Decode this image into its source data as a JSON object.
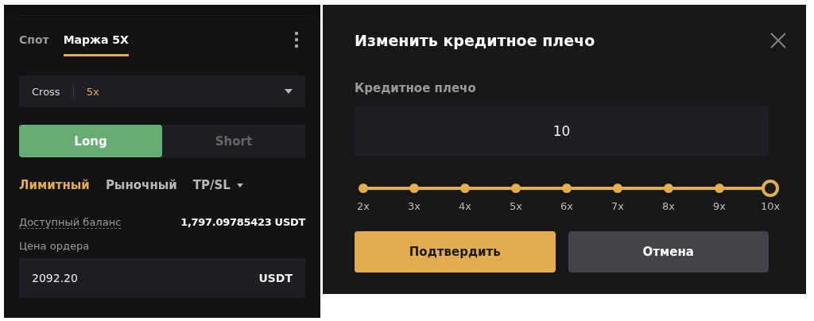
{
  "left_panel": {
    "tabs": [
      {
        "label": "Спот",
        "selected": false
      },
      {
        "label": "Маржа 5X",
        "selected": true
      }
    ],
    "margin_select": {
      "mode": "Cross",
      "leverage": "5x"
    },
    "sides": [
      {
        "label": "Long",
        "selected": true
      },
      {
        "label": "Short",
        "selected": false
      }
    ],
    "order_types": [
      {
        "label": "Лимитный",
        "selected": true,
        "kind": "tab"
      },
      {
        "label": "Рыночный",
        "selected": false,
        "kind": "tab"
      },
      {
        "label": "TP/SL",
        "selected": false,
        "kind": "dropdown"
      }
    ],
    "balance": {
      "label": "Доступный баланс",
      "value": "1,797.09785423 USDT"
    },
    "price": {
      "label": "Цена ордера",
      "value": "2092.20",
      "unit": "USDT"
    }
  },
  "dialog": {
    "title": "Изменить кредитное плечо",
    "field_label": "Кредитное плечо",
    "value": "10",
    "slider": {
      "level": 1,
      "marks": [
        "2x",
        "3x",
        "4x",
        "5x",
        "6x",
        "7x",
        "8x",
        "9x",
        "10x"
      ]
    },
    "buttons": [
      {
        "label": "Подтвердить",
        "kind": "primary"
      },
      {
        "label": "Отмена",
        "kind": "secondary"
      }
    ]
  }
}
